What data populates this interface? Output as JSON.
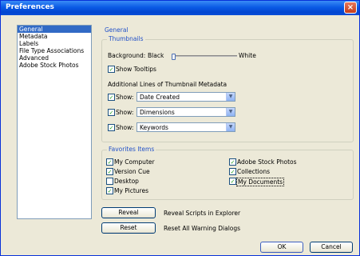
{
  "window": {
    "title": "Preferences",
    "close_glyph": "×"
  },
  "sidebar": {
    "items": [
      {
        "label": "General",
        "selected": true
      },
      {
        "label": "Metadata"
      },
      {
        "label": "Labels"
      },
      {
        "label": "File Type Associations"
      },
      {
        "label": "Advanced"
      },
      {
        "label": "Adobe Stock Photos"
      }
    ]
  },
  "general": {
    "section_title": "General",
    "thumbnails": {
      "group_title": "Thumbnails",
      "background_label": "Background:",
      "black_label": "Black",
      "white_label": "White",
      "background_level": 0,
      "show_tooltips": {
        "label": "Show Tooltips",
        "checked": true
      },
      "additional_lines_label": "Additional Lines of Thumbnail Metadata",
      "metadata_rows": [
        {
          "label": "Show:",
          "checked": true,
          "value": "Date Created"
        },
        {
          "label": "Show:",
          "checked": true,
          "value": "Dimensions"
        },
        {
          "label": "Show:",
          "checked": true,
          "value": "Keywords"
        }
      ]
    },
    "favorites": {
      "group_title": "Favorites Items",
      "left_items": [
        {
          "label": "My Computer",
          "checked": true
        },
        {
          "label": "Version Cue",
          "checked": true
        },
        {
          "label": "Desktop",
          "checked": false
        },
        {
          "label": "My Pictures",
          "checked": true
        }
      ],
      "right_items": [
        {
          "label": "Adobe Stock Photos",
          "checked": true
        },
        {
          "label": "Collections",
          "checked": true
        },
        {
          "label": "My Documents",
          "checked": true
        }
      ]
    },
    "reveal_button": "Reveal",
    "reveal_description": "Reveal Scripts in Explorer",
    "reset_button": "Reset",
    "reset_description": "Reset All Warning Dialogs"
  },
  "footer": {
    "ok_label": "OK",
    "cancel_label": "Cancel"
  },
  "glyphs": {
    "check": "✓",
    "dropdown": "▼"
  },
  "colors": {
    "titlebar": "#0a5ae5",
    "selection": "#316ac5",
    "group_title": "#2251c8",
    "dialog_bg": "#ece9d8"
  }
}
